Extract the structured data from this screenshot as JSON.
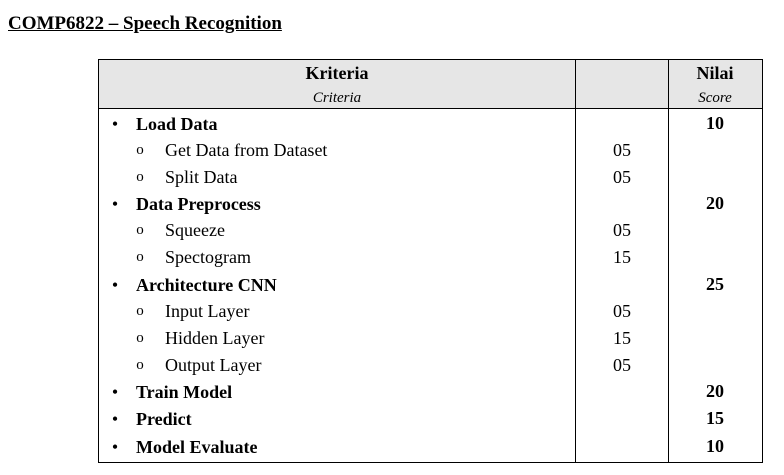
{
  "document": {
    "title": "COMP6822 – Speech Recognition"
  },
  "table": {
    "headers": {
      "criteria_label": "Kriteria",
      "criteria_sublabel": "Criteria",
      "score_label": "Nilai",
      "score_sublabel": "Score"
    },
    "criteria": [
      {
        "name": "Load Data",
        "score": "10",
        "subitems": [
          {
            "name": "Get Data from Dataset",
            "points": "05"
          },
          {
            "name": "Split Data",
            "points": "05"
          }
        ]
      },
      {
        "name": "Data Preprocess",
        "score": "20",
        "subitems": [
          {
            "name": "Squeeze",
            "points": "05"
          },
          {
            "name": "Spectogram",
            "points": "15"
          }
        ]
      },
      {
        "name": "Architecture CNN",
        "score": "25",
        "subitems": [
          {
            "name": "Input Layer",
            "points": "05"
          },
          {
            "name": "Hidden Layer",
            "points": "15"
          },
          {
            "name": "Output Layer",
            "points": "05"
          }
        ]
      },
      {
        "name": "Train Model",
        "score": "20",
        "subitems": []
      },
      {
        "name": "Predict",
        "score": "15",
        "subitems": []
      },
      {
        "name": "Model Evaluate",
        "score": "10",
        "subitems": []
      }
    ]
  },
  "icons": {
    "bullet": "•",
    "sub_bullet": "o"
  }
}
